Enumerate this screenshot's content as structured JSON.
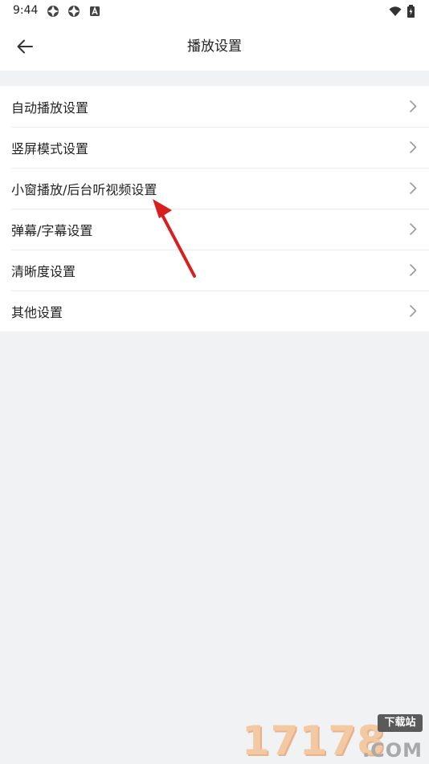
{
  "status_bar": {
    "time": "9:44",
    "left_icons": [
      "aperture-icon",
      "aperture-icon",
      "a-letter-icon"
    ],
    "right_icons": [
      "wifi-icon",
      "battery-icon"
    ]
  },
  "app_bar": {
    "title": "播放设置",
    "back_icon": "arrow-left-icon"
  },
  "settings": {
    "items": [
      {
        "label": "自动播放设置"
      },
      {
        "label": "竖屏模式设置"
      },
      {
        "label": "小窗播放/后台听视频设置"
      },
      {
        "label": "弹幕/字幕设置"
      },
      {
        "label": "清晰度设置"
      },
      {
        "label": "其他设置"
      }
    ]
  },
  "annotation": {
    "color": "#e02020"
  },
  "watermark": {
    "digits": "17178",
    "badge": "下载站",
    "suffix": ".COM"
  },
  "colors": {
    "background": "#f1f2f4",
    "surface": "#ffffff",
    "text": "#222222",
    "chevron": "#9a9a9a"
  }
}
